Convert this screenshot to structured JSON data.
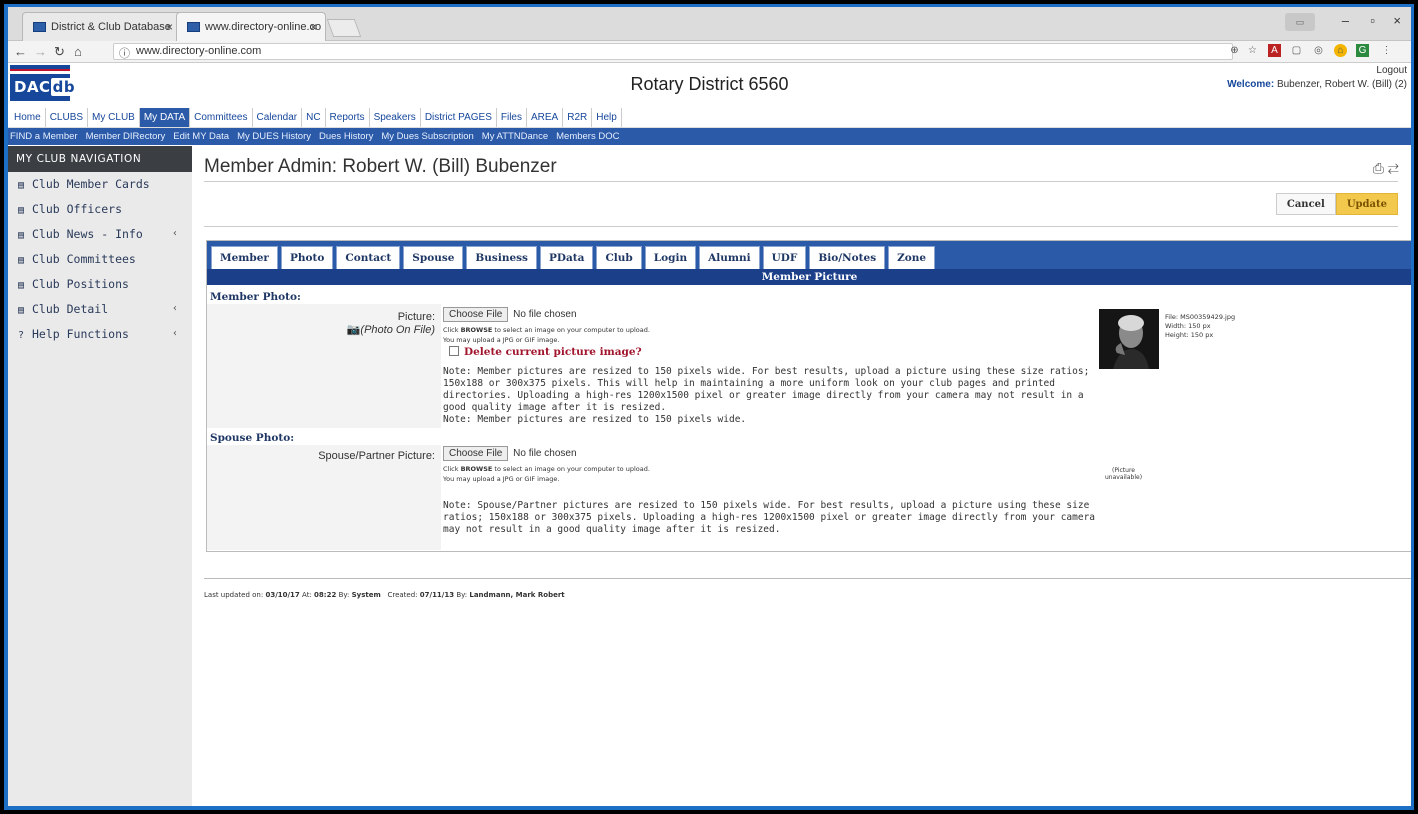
{
  "browser": {
    "tabs": [
      {
        "title": "District & Club Database"
      },
      {
        "title": "www.directory-online.co"
      }
    ],
    "url": "www.directory-online.com",
    "window_controls": {
      "minimize": "–",
      "maximize": "▫",
      "close": "×"
    }
  },
  "site": {
    "logo_text_a": "DAC",
    "logo_text_b": "db",
    "district_title": "Rotary District 6560",
    "logout_label": "Logout",
    "welcome_prefix": "Welcome:",
    "welcome_user": "Bubenzer, Robert W. (Bill) (2)"
  },
  "main_menu": [
    "Home",
    "CLUBS",
    "My CLUB",
    "My DATA",
    "Committees",
    "Calendar",
    "NC",
    "Reports",
    "Speakers",
    "District PAGES",
    "Files",
    "AREA",
    "R2R",
    "Help"
  ],
  "main_menu_active": "My DATA",
  "sub_menu": [
    "FIND a Member",
    "Member DIRectory",
    "Edit MY Data",
    "My DUES History",
    "Dues History",
    "My Dues Subscription",
    "My ATTNDance",
    "Members DOC"
  ],
  "sidebar": {
    "title": "MY CLUB NAVIGATION",
    "items": [
      {
        "label": "Club Member Cards",
        "icon": "list-icon",
        "glyph": "▤",
        "chevron": false
      },
      {
        "label": "Club Officers",
        "icon": "list-icon",
        "glyph": "▤",
        "chevron": false
      },
      {
        "label": "Club News - Info",
        "icon": "list-icon",
        "glyph": "▤",
        "chevron": true
      },
      {
        "label": "Club Committees",
        "icon": "list-icon",
        "glyph": "▤",
        "chevron": false
      },
      {
        "label": "Club Positions",
        "icon": "list-icon",
        "glyph": "▤",
        "chevron": false
      },
      {
        "label": "Club Detail",
        "icon": "card-icon",
        "glyph": "▤",
        "chevron": true
      },
      {
        "label": "Help Functions",
        "icon": "question-icon",
        "glyph": "?",
        "chevron": true
      }
    ]
  },
  "page": {
    "title": "Member Admin: Robert W. (Bill) Bubenzer",
    "cancel_label": "Cancel",
    "update_label": "Update",
    "tabs": [
      "Member",
      "Photo",
      "Contact",
      "Spouse",
      "Business",
      "PData",
      "Club",
      "Login",
      "Alumni",
      "UDF",
      "Bio/Notes",
      "Zone"
    ],
    "active_tab": "Photo",
    "section_title": "Member Picture"
  },
  "member_photo": {
    "heading": "Member Photo:",
    "label": "Picture:",
    "on_file": "(Photo On File)",
    "choose_file": "Choose File",
    "no_file": "No file chosen",
    "help1_pre": "Click ",
    "help1_bold": "BROWSE",
    "help1_post": " to select an image on your computer to upload.",
    "help2": "You may upload a JPG or GIF image.",
    "delete_label": "Delete current picture image?",
    "note1": "Note: Member pictures are resized to 150 pixels wide. For best results, upload a picture using these size ratios; 150x188 or 300x375 pixels. This will help in maintaining a more uniform look on your club pages and printed directories. Uploading a high-res 1200x1500 pixel or greater image directly from your camera may not result in a good quality image after it is resized.",
    "note2": "Note: Member pictures are resized to 150 pixels wide.",
    "file_name": "File: MS00359429.jpg",
    "file_width": "Width: 150 px",
    "file_height": "Height: 150 px"
  },
  "spouse_photo": {
    "heading": "Spouse Photo:",
    "label": "Spouse/Partner Picture:",
    "choose_file": "Choose File",
    "no_file": "No file chosen",
    "help1_pre": "Click ",
    "help1_bold": "BROWSE",
    "help1_post": " to select an image on your computer to upload.",
    "help2": "You may upload a JPG or GIF image.",
    "unavailable_1": "(Picture",
    "unavailable_2": "unavailable)",
    "note": "Note: Spouse/Partner pictures are resized to 150 pixels wide. For best results, upload a picture using these size ratios; 150x188 or 300x375 pixels. Uploading a high-res 1200x1500 pixel or greater image directly from your camera may not result in a good quality image after it is resized."
  },
  "footer": {
    "updated_prefix": "Last updated on:",
    "updated_date": "03/10/17",
    "at": "At:",
    "updated_time": "08:22",
    "by": "By:",
    "updated_by": "System",
    "created_prefix": "Created:",
    "created_date": "07/11/13",
    "created_by_prefix": "By:",
    "created_by": "Landmann, Mark Robert"
  }
}
